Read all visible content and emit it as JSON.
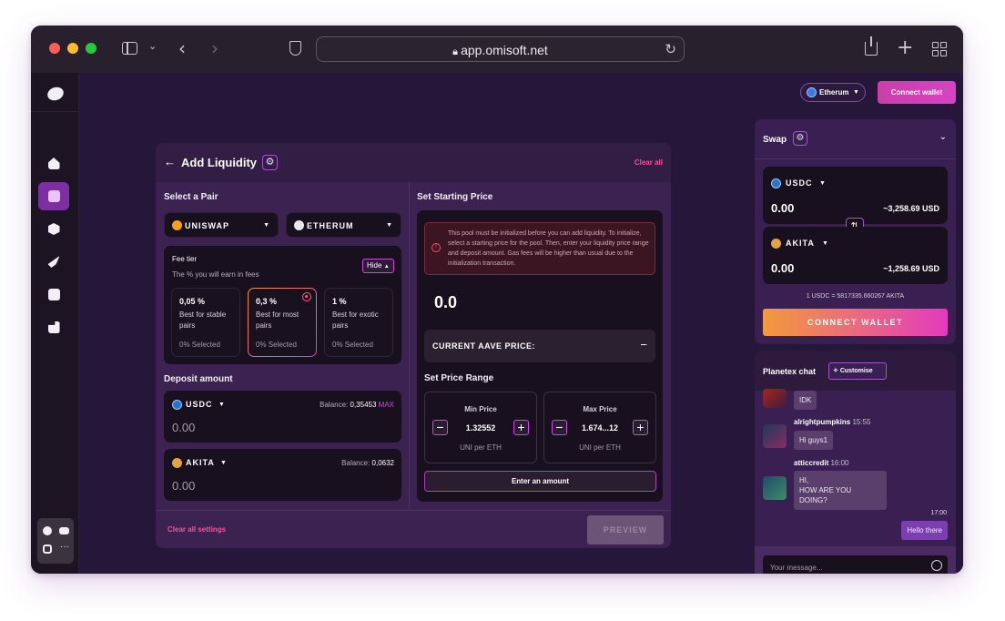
{
  "browser": {
    "url": "app.omisoft.net"
  },
  "topbar": {
    "network": "Etherum",
    "connect": "Connect wallet"
  },
  "liquidity": {
    "title": "Add Liquidity",
    "clear_all": "Clear all",
    "select_pair": "Select a Pair",
    "pair_a": "UNISWAP",
    "pair_b": "ETHERUM",
    "fee_tier": "Fee tier",
    "fee_sub": "The % you will earn in fees",
    "hide": "Hide",
    "fees": [
      {
        "pct": "0,05 %",
        "desc": "Best for stable pairs",
        "selected": "0% Selected"
      },
      {
        "pct": "0,3 %",
        "desc": "Best for most pairs",
        "selected": "0% Selected"
      },
      {
        "pct": "1 %",
        "desc": "Best for exotic pairs",
        "selected": "0% Selected"
      }
    ],
    "deposit_title": "Deposit amount",
    "deposits": [
      {
        "token": "USDC",
        "balance_label": "Balance:",
        "balance": "0,35453",
        "max": "MAX",
        "amount": "0.00"
      },
      {
        "token": "AKITA",
        "balance_label": "Balance:",
        "balance": "0,0632",
        "amount": "0.00"
      }
    ],
    "start_price_title": "Set Starting Price",
    "warning": "This pool must be initialized before you can add liquidity. To initialize, select a starting price for the pool. Then, enter your liquidity price range and deposit amount. Gas fees will be higher than usual due to the initialization transaction.",
    "price": "0.0",
    "aave": "CURRENT AAVE PRICE:",
    "aave_toggle": "−",
    "range_title": "Set Price Range",
    "min": {
      "label": "Min Price",
      "value": "1.32552",
      "unit": "UNI per ETH"
    },
    "max": {
      "label": "Max Price",
      "value": "1.674...12",
      "unit": "UNI per ETH"
    },
    "enter_amount": "Enter an amount",
    "clear_settings": "Clear all settings",
    "preview": "PREVIEW"
  },
  "swap": {
    "title": "Swap",
    "from": {
      "token": "USDC",
      "amount": "0.00",
      "usd": "~3,258.69 USD"
    },
    "to": {
      "token": "AKITA",
      "amount": "0.00",
      "usd": "~1,258.69 USD"
    },
    "rate": "1 USDC = 5817335.660267 AKITA",
    "connect": "CONNECT WALLET"
  },
  "chat": {
    "title": "Planetex chat",
    "customise": "Customise",
    "m0": {
      "text": "IDK"
    },
    "m1": {
      "user": "alrightpumpkins",
      "time": "15:55",
      "text": "Hi guys1"
    },
    "m2": {
      "user": "atticcredit",
      "time": "16:00",
      "l1": "HI,",
      "l2": "HOW ARE YOU DOING?"
    },
    "m3": {
      "time": "17:00",
      "text": "Hello there"
    },
    "placeholder": "Your message..."
  },
  "colors": {
    "accent": "#e0338d",
    "gradient_start": "#f39a3c",
    "gradient_end": "#e23bbe",
    "panel": "#3b2250"
  }
}
